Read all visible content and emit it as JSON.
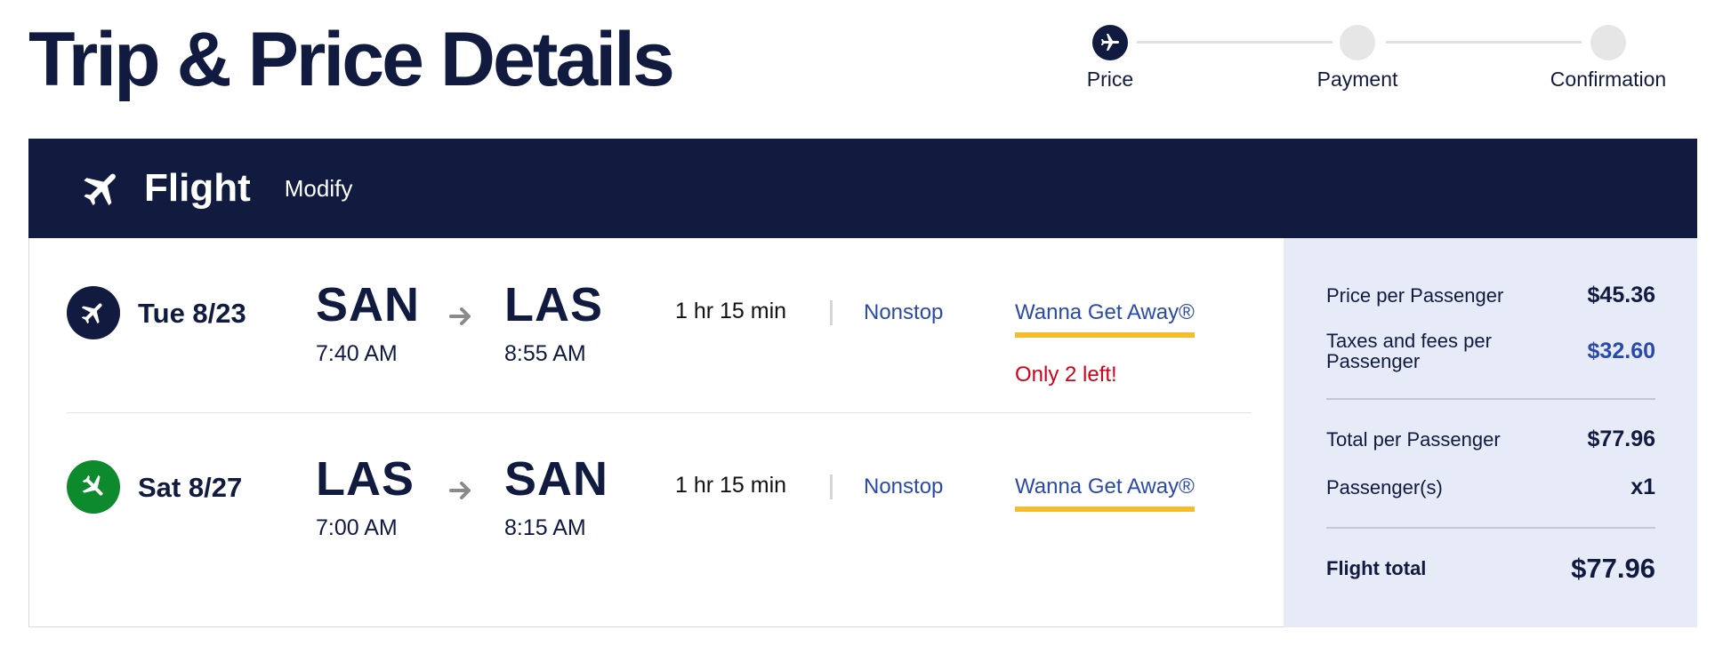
{
  "page": {
    "title": "Trip & Price Details"
  },
  "stepper": {
    "steps": [
      {
        "label": "Price",
        "active": true,
        "icon": "plane-icon"
      },
      {
        "label": "Payment",
        "active": false
      },
      {
        "label": "Confirmation",
        "active": false
      }
    ]
  },
  "flight_section": {
    "title": "Flight",
    "modify_label": "Modify",
    "icon": "plane-icon"
  },
  "legs": [
    {
      "date": "Tue 8/23",
      "icon": "departing-plane-icon",
      "icon_color": "#111b40",
      "from_code": "SAN",
      "from_time": "7:40 AM",
      "to_code": "LAS",
      "to_time": "8:55 AM",
      "duration": "1 hr 15 min",
      "stops": "Nonstop",
      "fare": "Wanna Get Away®",
      "seats_left": "Only 2 left!"
    },
    {
      "date": "Sat 8/27",
      "icon": "returning-plane-icon",
      "icon_color": "#0d8a2c",
      "from_code": "LAS",
      "from_time": "7:00 AM",
      "to_code": "SAN",
      "to_time": "8:15 AM",
      "duration": "1 hr 15 min",
      "stops": "Nonstop",
      "fare": "Wanna Get Away®"
    }
  ],
  "price_summary": {
    "price_per_passenger_label": "Price per Passenger",
    "price_per_passenger": "$45.36",
    "taxes_label": "Taxes and fees per Passenger",
    "taxes": "$32.60",
    "total_per_passenger_label": "Total per Passenger",
    "total_per_passenger": "$77.96",
    "passengers_label": "Passenger(s)",
    "passengers": "x1",
    "flight_total_label": "Flight total",
    "flight_total": "$77.96"
  },
  "colors": {
    "navy": "#111b40",
    "link_blue": "#2b4aa8",
    "fare_underline": "#f5bd2b",
    "alert_red": "#d0021b",
    "return_green": "#0d8a2c",
    "panel_bg": "#e6ebf7"
  }
}
